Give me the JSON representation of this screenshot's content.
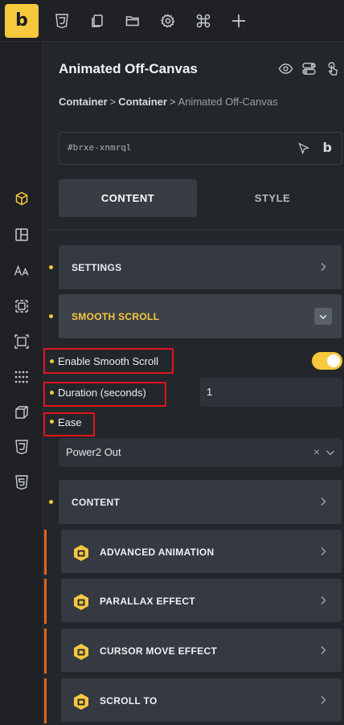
{
  "topbar": {
    "logo_letter": "b",
    "icons": [
      "css3-icon",
      "pages-icon",
      "folder-icon",
      "gear-icon",
      "command-icon",
      "plus-icon"
    ]
  },
  "leftbar": {
    "icons": [
      "cube-icon",
      "layout-icon",
      "typography-icon",
      "spacing-icon",
      "border-icon",
      "grid-dots-icon",
      "transform-icon",
      "css3-icon",
      "html5-icon"
    ]
  },
  "header": {
    "title": "Animated Off-Canvas",
    "breadcrumb": {
      "a": "Container",
      "sep1": ">",
      "b": "Container",
      "sep2": ">",
      "current": "Animated Off-Canvas"
    }
  },
  "id_field": {
    "value": "#brxe-xnmrql",
    "builder_letter": "b"
  },
  "tabs": {
    "content": "CONTENT",
    "style": "STYLE"
  },
  "sections": {
    "settings": "SETTINGS",
    "smooth_scroll": "SMOOTH SCROLL",
    "content": "CONTENT"
  },
  "smooth_scroll": {
    "enable_label": "Enable Smooth Scroll",
    "enabled": true,
    "duration_label": "Duration (seconds)",
    "duration_value": "1",
    "ease_label": "Ease",
    "ease_value": "Power2 Out",
    "clear_glyph": "×"
  },
  "addons": [
    {
      "label": "ADVANCED ANIMATION"
    },
    {
      "label": "PARALLAX EFFECT"
    },
    {
      "label": "CURSOR MOVE EFFECT"
    },
    {
      "label": "SCROLL TO"
    }
  ],
  "colors": {
    "accent": "#f6c83e",
    "highlight": "#e0141c",
    "addon_bar": "#e0661a"
  }
}
